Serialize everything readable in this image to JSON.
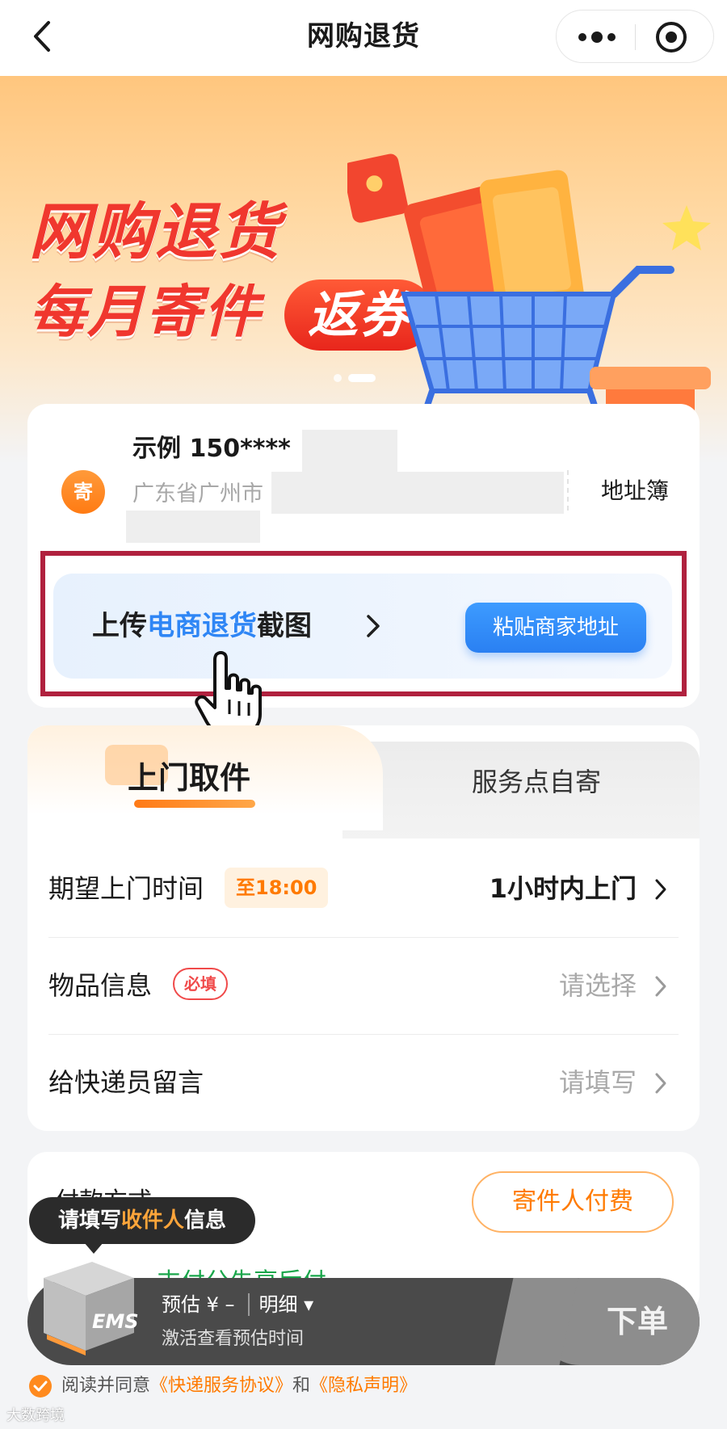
{
  "header": {
    "title": "网购退货"
  },
  "banner": {
    "line1": "网购退货",
    "line2": "每月寄件",
    "pill": "返券"
  },
  "sender": {
    "badge": "寄",
    "name": "示例 150****",
    "address": "广东省广州市",
    "address_book": "地址簿"
  },
  "upload": {
    "prefix": "上传",
    "highlight": "电商退货",
    "suffix": "截图",
    "paste_button": "粘贴商家地址"
  },
  "pickup": {
    "tabs": [
      {
        "label": "上门取件",
        "active": true
      },
      {
        "label": "服务点自寄",
        "active": false
      }
    ],
    "rows": {
      "time": {
        "label": "期望上门时间",
        "tag": "至18:00",
        "value": "1小时内上门"
      },
      "item": {
        "label": "物品信息",
        "tag": "必填",
        "value": "请选择"
      },
      "note": {
        "label": "给快递员留言",
        "value": "请填写"
      }
    }
  },
  "payment": {
    "label": "付款方式",
    "payer_button": "寄件人付费",
    "hidden_line": "支付分先享后付"
  },
  "tooltip": {
    "prefix": "请填写",
    "highlight": "收件人",
    "suffix": "信息"
  },
  "order_bar": {
    "estimate_label": "预估 ¥ –",
    "detail_label": "明细",
    "sub_text": "激活查看预估时间",
    "order_button": "下单",
    "box_label": "EMS"
  },
  "agreement": {
    "prefix": "阅读并同意",
    "link1": "《快递服务协议》",
    "conj": "和",
    "link2": "《隐私声明》"
  },
  "watermark": "大数跨境",
  "colors": {
    "accent_orange": "#ff7a00",
    "accent_blue": "#2f86f5",
    "banner_red": "#f0372e",
    "highlight_frame": "#b0213e"
  }
}
